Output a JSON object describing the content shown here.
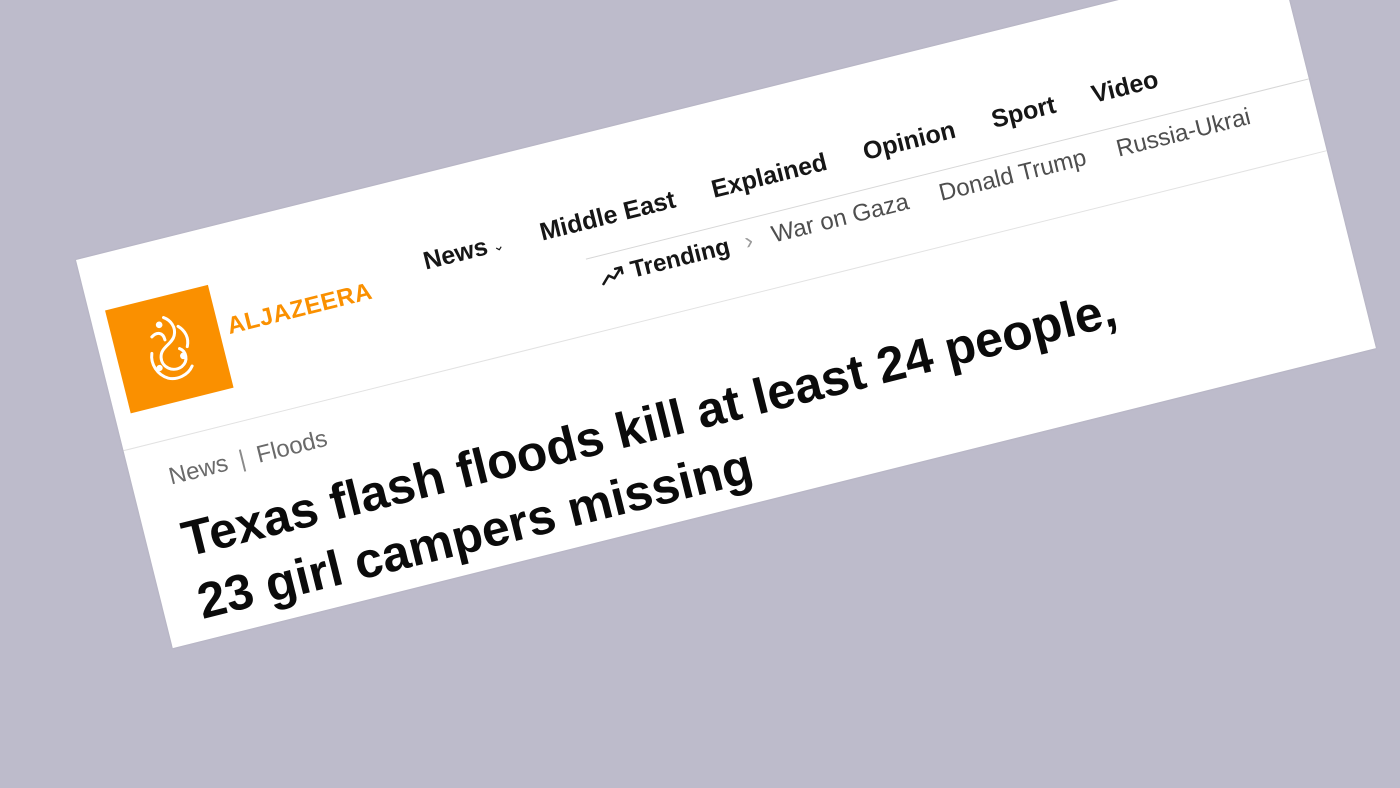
{
  "brand": {
    "name": "ALJAZEERA",
    "logo_icon": "aljazeera-calligraphy-logo",
    "accent_color": "#fa9000"
  },
  "nav": {
    "items": [
      {
        "label": "News",
        "has_dropdown": true
      },
      {
        "label": "Middle East"
      },
      {
        "label": "Explained"
      },
      {
        "label": "Opinion"
      },
      {
        "label": "Sport"
      },
      {
        "label": "Video"
      }
    ]
  },
  "trending": {
    "label": "Trending",
    "icon": "trending-up-icon",
    "topics": [
      "War on Gaza",
      "Donald Trump",
      "Russia-Ukrai"
    ]
  },
  "breadcrumb": {
    "items": [
      "News",
      "Floods"
    ],
    "separator": "|"
  },
  "article": {
    "headline_line1": "Texas flash floods kill at least 24 people,",
    "headline_line2": "23 girl campers missing"
  }
}
